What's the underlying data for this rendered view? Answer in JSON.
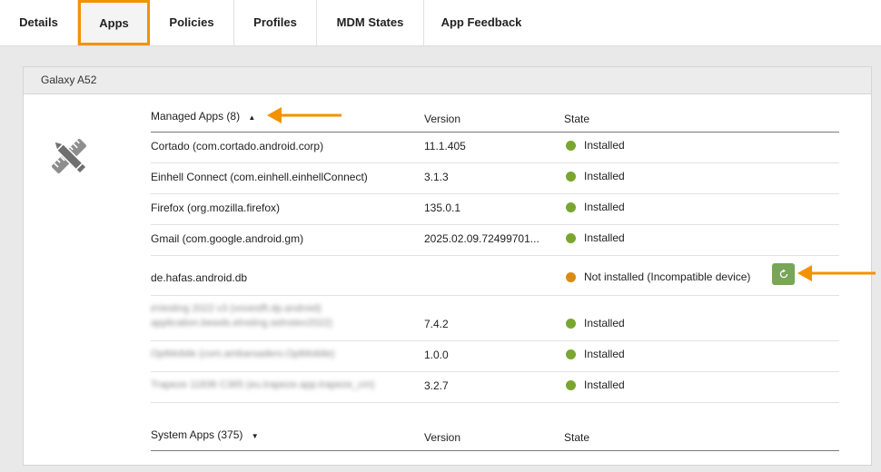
{
  "tabs": [
    {
      "label": "Details"
    },
    {
      "label": "Apps"
    },
    {
      "label": "Policies"
    },
    {
      "label": "Profiles"
    },
    {
      "label": "MDM States"
    },
    {
      "label": "App Feedback"
    }
  ],
  "panel": {
    "title": "Galaxy A52"
  },
  "managed_apps": {
    "header": "Managed Apps (8)",
    "sort_icon": "caret-up-icon",
    "columns": {
      "version": "Version",
      "state": "State"
    },
    "rows": [
      {
        "name": "Cortado (com.cortado.android.corp)",
        "version": "11.1.405",
        "state": "Installed",
        "status": "green"
      },
      {
        "name": "Einhell Connect (com.einhell.einhellConnect)",
        "version": "3.1.3",
        "state": "Installed",
        "status": "green"
      },
      {
        "name": "Firefox (org.mozilla.firefox)",
        "version": "135.0.1",
        "state": "Installed",
        "status": "green"
      },
      {
        "name": "Gmail (com.google.android.gm)",
        "version": "2025.02.09.72499701...",
        "state": "Installed",
        "status": "green"
      },
      {
        "name": "de.hafas.android.db",
        "version": "",
        "state": "Not installed (Incompatible device)",
        "status": "orange",
        "action_icon": "retry-icon"
      },
      {
        "name_line1": "eVesting 2022 v3 (vovestft.dp.android)",
        "name_line2": "application.bewds.elnsting.selnstev2022)",
        "version": "7.4.2",
        "state": "Installed",
        "status": "green",
        "blurred": true
      },
      {
        "name": "OptMobile (com.ambarsadero.OptMobile)",
        "version": "1.0.0",
        "state": "Installed",
        "status": "green",
        "blurred": true
      },
      {
        "name": "Trapeze 11836 C365 (eu.trapeze.app.trapeze_cm)",
        "version": "3.2.7",
        "state": "Installed",
        "status": "green",
        "blurred": true
      }
    ]
  },
  "system_apps": {
    "header": "System Apps (375)",
    "sort_icon": "caret-down-icon",
    "columns": {
      "version": "Version",
      "state": "State"
    }
  },
  "colors": {
    "accent_orange": "#f39200",
    "status_green": "#7aa630",
    "status_orange": "#d98c12",
    "button_green": "#78a55a"
  }
}
